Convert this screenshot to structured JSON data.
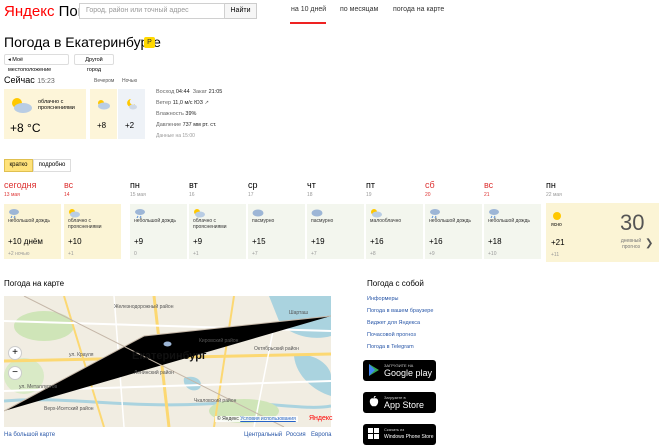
{
  "header": {
    "logo_brand": "Яндекс",
    "logo_service": "Погода",
    "search_placeholder": "Город, район или точный адрес",
    "search_button": "Найти",
    "nav": [
      {
        "label": "на 10 дней",
        "active": true
      },
      {
        "label": "по месяцам"
      },
      {
        "label": "погода на карте"
      }
    ]
  },
  "title": "Погода в Екатеринбурге",
  "title_badge": "P",
  "buttons": {
    "my_location": "Моё местоположение",
    "other_city": "Другой город"
  },
  "now": {
    "label": "Сейчас",
    "time": "15:23",
    "condition": "облачно с прояснениями",
    "temp": "+8 °C",
    "evening_label": "Вечером",
    "evening_temp": "+8",
    "night_label": "Ночью",
    "night_temp": "+2"
  },
  "details": {
    "sunrise_label": "Восход",
    "sunrise": "04:44",
    "sunset_label": "Закат",
    "sunset": "21:05",
    "wind_label": "Ветер",
    "wind": "11,0 м/с",
    "wind_dir": "ЮЗ",
    "humidity_label": "Влажность",
    "humidity": "39%",
    "pressure_label": "Давление",
    "pressure": "737 мм рт. ст.",
    "updated": "Данные на 15:00"
  },
  "tabs": {
    "short": "кратко",
    "full": "подробно"
  },
  "forecast": [
    {
      "day": "сегодня",
      "date": "13 мая",
      "condition": "небольшой дождь",
      "temp": "+10 днём",
      "night": "+2 ночью",
      "red": true
    },
    {
      "day": "вс",
      "date": "14",
      "condition": "облачно с прояснениями",
      "temp": "+10",
      "night": "+1",
      "red": true
    },
    {
      "day": "пн",
      "date": "15 мая",
      "condition": "небольшой дождь",
      "temp": "+9",
      "night": "0"
    },
    {
      "day": "вт",
      "date": "16",
      "condition": "облачно с прояснениями",
      "temp": "+9",
      "night": "+1"
    },
    {
      "day": "ср",
      "date": "17",
      "condition": "пасмурно",
      "temp": "+15",
      "night": "+7"
    },
    {
      "day": "чт",
      "date": "18",
      "condition": "пасмурно",
      "temp": "+19",
      "night": "+7"
    },
    {
      "day": "пт",
      "date": "19",
      "condition": "малооблачно",
      "temp": "+16",
      "night": "+8"
    },
    {
      "day": "сб",
      "date": "20",
      "condition": "небольшой дождь",
      "temp": "+16",
      "night": "+9",
      "red": true
    },
    {
      "day": "вс",
      "date": "21",
      "condition": "небольшой дождь",
      "temp": "+18",
      "night": "+10",
      "red": true
    }
  ],
  "last_day": {
    "day": "пн",
    "date": "22 мая",
    "condition": "ясно",
    "temp": "+21",
    "night": "+11"
  },
  "thirty": {
    "number": "30",
    "label": "дневный прогноз"
  },
  "map": {
    "title": "Погода на карте",
    "city": "Екатеринбург",
    "temp": "+8",
    "labels": [
      "ул. Металлургов",
      "ул. Крауля",
      "Кировский район",
      "Железнодорожный район",
      "Октябрьский район",
      "Ленинский район",
      "Чкаловский район",
      "Верх-Исетский район",
      "Шарташ"
    ],
    "copyright_prefix": "© Яндекс",
    "terms": "Условия использования",
    "ylogo": "Яндекс",
    "big_map": "На большой карте",
    "regions": [
      "Центральный",
      "Россия",
      "Европа"
    ]
  },
  "sidebar": {
    "title": "Погода с собой",
    "links": [
      "Информеры",
      "Погода в вашем браузере",
      "Виджет для Яндекса",
      "Почасовой прогноз",
      "Погода в Telegram"
    ],
    "stores": [
      {
        "top": "ЗАГРУЗИТЕ НА",
        "name": "Google play"
      },
      {
        "top": "Загрузите в",
        "name": "App Store"
      },
      {
        "top": "Скачать из",
        "name": "Windows Phone Store"
      }
    ]
  },
  "colors": {
    "accent": "#ffd800",
    "nav_active": "#e22222",
    "link": "#2957a8",
    "weekend": "#d33333"
  }
}
